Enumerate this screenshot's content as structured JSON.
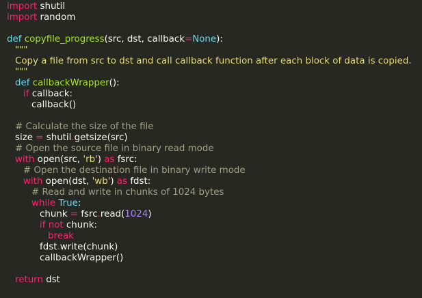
{
  "editor": {
    "theme_background": "#272822",
    "lines": [
      {
        "indent": 0,
        "tokens": [
          {
            "t": "kw",
            "v": "import"
          },
          {
            "t": "plain",
            "v": " shutil"
          }
        ]
      },
      {
        "indent": 0,
        "tokens": [
          {
            "t": "kw",
            "v": "import"
          },
          {
            "t": "plain",
            "v": " random"
          }
        ]
      },
      {
        "indent": 0,
        "tokens": []
      },
      {
        "indent": 0,
        "tokens": [
          {
            "t": "def",
            "v": "def"
          },
          {
            "t": "plain",
            "v": " "
          },
          {
            "t": "fn",
            "v": "copyfile_progress"
          },
          {
            "t": "plain",
            "v": "(src, dst, callback"
          },
          {
            "t": "kw",
            "v": "="
          },
          {
            "t": "const",
            "v": "None"
          },
          {
            "t": "plain",
            "v": "):"
          }
        ]
      },
      {
        "indent": 1,
        "tokens": [
          {
            "t": "str",
            "v": "\"\"\""
          }
        ]
      },
      {
        "indent": 1,
        "tokens": [
          {
            "t": "str",
            "v": "Copy a file from src to dst and call callback function after each block of data is copied."
          }
        ]
      },
      {
        "indent": 1,
        "tokens": [
          {
            "t": "str",
            "v": "\"\"\""
          }
        ]
      },
      {
        "indent": 1,
        "tokens": [
          {
            "t": "def",
            "v": "def"
          },
          {
            "t": "plain",
            "v": " "
          },
          {
            "t": "fn",
            "v": "callbackWrapper"
          },
          {
            "t": "plain",
            "v": "():"
          }
        ]
      },
      {
        "indent": 2,
        "tokens": [
          {
            "t": "kw",
            "v": "if"
          },
          {
            "t": "plain",
            "v": " callback:"
          }
        ]
      },
      {
        "indent": 3,
        "tokens": [
          {
            "t": "plain",
            "v": "callback()"
          }
        ]
      },
      {
        "indent": 0,
        "tokens": []
      },
      {
        "indent": 1,
        "tokens": [
          {
            "t": "com",
            "v": "# Calculate the size of the file"
          }
        ]
      },
      {
        "indent": 1,
        "tokens": [
          {
            "t": "plain",
            "v": "size "
          },
          {
            "t": "kw",
            "v": "="
          },
          {
            "t": "plain",
            "v": " shutil"
          },
          {
            "t": "kw",
            "v": "."
          },
          {
            "t": "plain",
            "v": "getsize(src)"
          }
        ]
      },
      {
        "indent": 1,
        "tokens": [
          {
            "t": "com",
            "v": "# Open the source file in binary read mode"
          }
        ]
      },
      {
        "indent": 1,
        "tokens": [
          {
            "t": "kw",
            "v": "with"
          },
          {
            "t": "plain",
            "v": " open(src, "
          },
          {
            "t": "str",
            "v": "'rb'"
          },
          {
            "t": "plain",
            "v": ") "
          },
          {
            "t": "kw",
            "v": "as"
          },
          {
            "t": "plain",
            "v": " fsrc:"
          }
        ]
      },
      {
        "indent": 2,
        "tokens": [
          {
            "t": "com",
            "v": "# Open the destination file in binary write mode"
          }
        ]
      },
      {
        "indent": 2,
        "tokens": [
          {
            "t": "kw",
            "v": "with"
          },
          {
            "t": "plain",
            "v": " open(dst, "
          },
          {
            "t": "str",
            "v": "'wb'"
          },
          {
            "t": "plain",
            "v": ") "
          },
          {
            "t": "kw",
            "v": "as"
          },
          {
            "t": "plain",
            "v": " fdst:"
          }
        ]
      },
      {
        "indent": 3,
        "tokens": [
          {
            "t": "com",
            "v": "# Read and write in chunks of 1024 bytes"
          }
        ]
      },
      {
        "indent": 3,
        "tokens": [
          {
            "t": "kw",
            "v": "while"
          },
          {
            "t": "plain",
            "v": " "
          },
          {
            "t": "const",
            "v": "True"
          },
          {
            "t": "plain",
            "v": ":"
          }
        ]
      },
      {
        "indent": 4,
        "tokens": [
          {
            "t": "plain",
            "v": "chunk "
          },
          {
            "t": "kw",
            "v": "="
          },
          {
            "t": "plain",
            "v": " fsrc"
          },
          {
            "t": "kw",
            "v": "."
          },
          {
            "t": "plain",
            "v": "read("
          },
          {
            "t": "num",
            "v": "1024"
          },
          {
            "t": "plain",
            "v": ")"
          }
        ]
      },
      {
        "indent": 4,
        "tokens": [
          {
            "t": "kw",
            "v": "if"
          },
          {
            "t": "plain",
            "v": " "
          },
          {
            "t": "kw",
            "v": "not"
          },
          {
            "t": "plain",
            "v": " chunk:"
          }
        ]
      },
      {
        "indent": 5,
        "tokens": [
          {
            "t": "kw",
            "v": "break"
          }
        ]
      },
      {
        "indent": 4,
        "tokens": [
          {
            "t": "plain",
            "v": "fdst"
          },
          {
            "t": "kw",
            "v": "."
          },
          {
            "t": "plain",
            "v": "write(chunk)"
          }
        ]
      },
      {
        "indent": 4,
        "tokens": [
          {
            "t": "plain",
            "v": "callbackWrapper()"
          }
        ]
      },
      {
        "indent": 0,
        "tokens": []
      },
      {
        "indent": 1,
        "tokens": [
          {
            "t": "kw",
            "v": "return"
          },
          {
            "t": "plain",
            "v": " dst"
          }
        ]
      }
    ]
  }
}
